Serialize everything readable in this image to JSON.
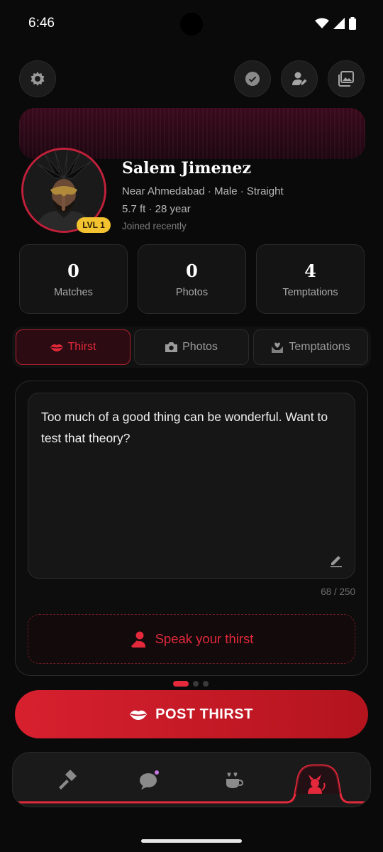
{
  "status_bar": {
    "time": "6:46"
  },
  "profile": {
    "name": "Salem Jimenez",
    "location_line": "Near Ahmedabad · Male · Straight",
    "stats_line": "5.7 ft · 28 year",
    "joined": "Joined recently",
    "level": "LVL 1"
  },
  "stats": [
    {
      "value": "0",
      "label": "Matches"
    },
    {
      "value": "0",
      "label": "Photos"
    },
    {
      "value": "4",
      "label": "Temptations"
    }
  ],
  "tabs": [
    {
      "label": "Thirst",
      "active": true
    },
    {
      "label": "Photos",
      "active": false
    },
    {
      "label": "Temptations",
      "active": false
    }
  ],
  "editor": {
    "text": "Too much of a good thing can be wonderful. Want to test that theory?",
    "counter": "68 / 250"
  },
  "speak_button": {
    "label": "Speak your thirst"
  },
  "post_button": {
    "label": "POST THIRST"
  },
  "pager": {
    "count": 3,
    "active_index": 0
  },
  "colors": {
    "accent": "#e3293b",
    "badge": "#f2c230",
    "background": "#0a0a0a"
  },
  "nav": {
    "items": [
      "hammer-icon",
      "chat-bubble-icon",
      "coffee-hearts-icon",
      "devil-icon"
    ],
    "active_index": 3
  }
}
